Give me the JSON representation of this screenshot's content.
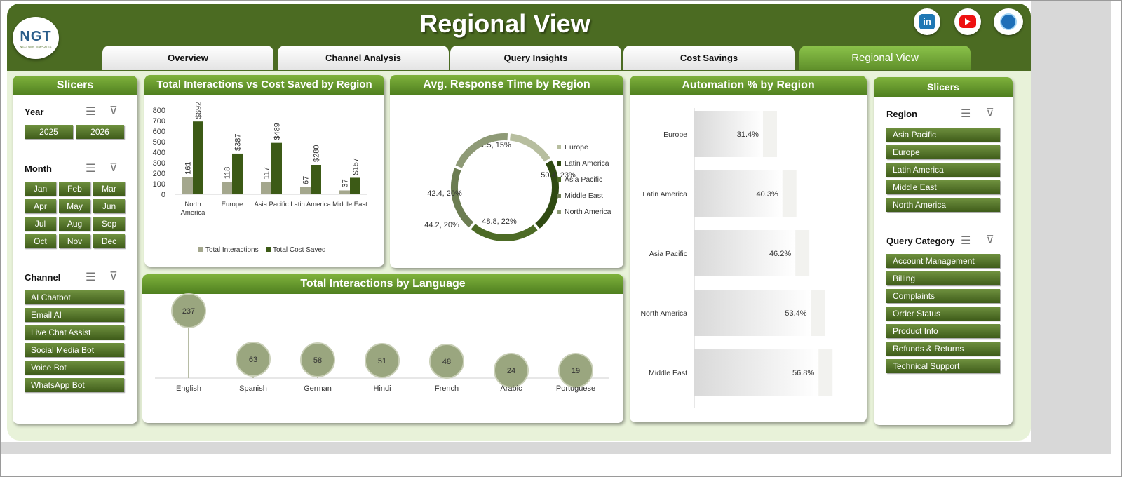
{
  "header": {
    "title": "Regional View",
    "logo_text": "NGT",
    "logo_sub": "NEXT GEN TEMPLATES",
    "tabs": [
      {
        "label": "Overview"
      },
      {
        "label": "Channel Analysis"
      },
      {
        "label": "Query Insights"
      },
      {
        "label": "Cost Savings"
      },
      {
        "label": "Regional View",
        "active": true
      }
    ],
    "social_icons": [
      "linkedin-icon",
      "youtube-icon",
      "globe-icon"
    ],
    "linkedin_text": "in"
  },
  "left_slicers": {
    "title": "Slicers",
    "year": {
      "label": "Year",
      "items": [
        "2025",
        "2026"
      ]
    },
    "month": {
      "label": "Month",
      "items": [
        "Jan",
        "Feb",
        "Mar",
        "Apr",
        "May",
        "Jun",
        "Jul",
        "Aug",
        "Sep",
        "Oct",
        "Nov",
        "Dec"
      ]
    },
    "channel": {
      "label": "Channel",
      "items": [
        "AI Chatbot",
        "Email AI",
        "Live Chat Assist",
        "Social Media Bot",
        "Voice Bot",
        "WhatsApp Bot"
      ]
    }
  },
  "right_slicers": {
    "title": "Slicers",
    "region": {
      "label": "Region",
      "items": [
        "Asia Pacific",
        "Europe",
        "Latin America",
        "Middle East",
        "North America"
      ]
    },
    "query_category": {
      "label": "Query Category",
      "items": [
        "Account Management",
        "Billing",
        "Complaints",
        "Order Status",
        "Product Info",
        "Refunds & Returns",
        "Technical Support"
      ]
    }
  },
  "colors": {
    "header_green": "#4b6b22",
    "accent_green": "#7fb23c",
    "light_bg": "#e8f2d9"
  },
  "chart_data": [
    {
      "type": "bar",
      "title": "Total Interactions vs Cost Saved by Region",
      "categories": [
        "North America",
        "Europe",
        "Asia Pacific",
        "Latin America",
        "Middle East"
      ],
      "series": [
        {
          "name": "Total Interactions",
          "values": [
            161,
            118,
            117,
            67,
            37
          ],
          "labels": [
            "161",
            "118",
            "117",
            "67",
            "37"
          ],
          "color": "#a4a78d"
        },
        {
          "name": "Total Cost Saved",
          "values": [
            692,
            387,
            489,
            280,
            157
          ],
          "labels": [
            "$692",
            "$387",
            "$489",
            "$280",
            "$157"
          ],
          "color": "#3c5a16"
        }
      ],
      "ylim": [
        0,
        800
      ],
      "yticks": [
        "0",
        "100",
        "200",
        "300",
        "400",
        "500",
        "600",
        "700",
        "800"
      ],
      "legend": "bottom"
    },
    {
      "type": "pie",
      "title": "Avg. Response Time by Region",
      "slices": [
        {
          "name": "Europe",
          "value": 31.5,
          "percent": 15,
          "label": "31.5, 15%",
          "color": "#b7be9f"
        },
        {
          "name": "Latin America",
          "value": 50.4,
          "percent": 23,
          "label": "50.4, 23%",
          "color": "#2f4a12"
        },
        {
          "name": "Asia Pacific",
          "value": 48.8,
          "percent": 22,
          "label": "48.8, 22%",
          "color": "#4d6b26"
        },
        {
          "name": "Middle East",
          "value": 44.2,
          "percent": 20,
          "label": "44.2, 20%",
          "color": "#6c7d52"
        },
        {
          "name": "North America",
          "value": 42.4,
          "percent": 20,
          "label": "42.4, 20%",
          "color": "#8e9a76"
        }
      ],
      "legend": "right"
    },
    {
      "type": "bar",
      "title": "Automation % by Region",
      "categories": [
        "Europe",
        "Latin America",
        "Asia Pacific",
        "North America",
        "Middle East"
      ],
      "values": [
        31.4,
        40.3,
        46.2,
        53.4,
        56.8
      ],
      "labels": [
        "31.4%",
        "40.3%",
        "46.2%",
        "53.4%",
        "56.8%"
      ],
      "orientation": "horizontal"
    },
    {
      "type": "scatter",
      "title": "Total Interactions by Language",
      "categories": [
        "English",
        "Spanish",
        "German",
        "Hindi",
        "French",
        "Arabic",
        "Portuguese"
      ],
      "values": [
        237,
        63,
        58,
        51,
        48,
        24,
        19
      ]
    }
  ]
}
